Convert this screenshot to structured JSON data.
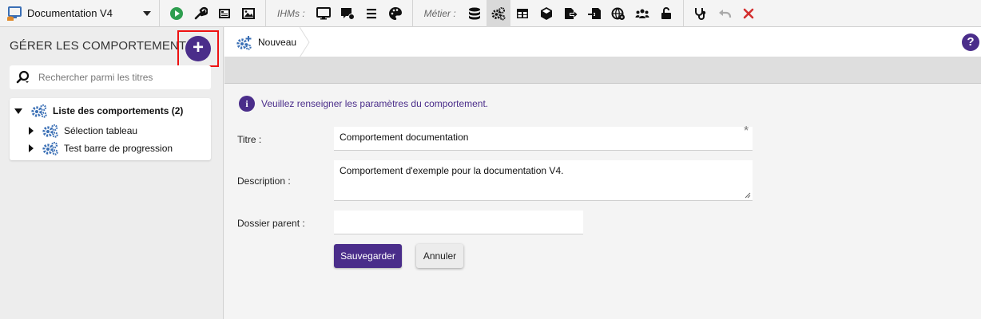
{
  "toolbar": {
    "project_name": "Documentation V4",
    "ihms_label": "IHMs :",
    "metier_label": "Métier :",
    "general_icons": [
      "play-icon",
      "wrench-icon",
      "book-icon",
      "image-icon"
    ],
    "ihm_icons": [
      "monitor-icon",
      "screen-alert-icon",
      "list-icon",
      "palette-icon"
    ],
    "metier_icons": [
      "database-icon",
      "gears-icon",
      "table-icon",
      "cube-icon",
      "export-icon",
      "import-icon",
      "globe-settings-icon",
      "users-icon",
      "unlock-icon"
    ],
    "end_icons": [
      "stethoscope-icon",
      "undo-icon",
      "close-icon"
    ]
  },
  "sidebar": {
    "title": "GÉRER LES COMPORTEMENTS",
    "add_label": "+",
    "search_placeholder": "Rechercher parmi les titres",
    "tree": {
      "root_label": "Liste des comportements (2)",
      "children": [
        {
          "label": "Sélection tableau"
        },
        {
          "label": "Test barre de progression"
        }
      ]
    }
  },
  "tab": {
    "label": "Nouveau",
    "help_label": "?"
  },
  "form": {
    "info_icon": "i",
    "info_text": "Veuillez renseigner les paramètres du comportement.",
    "title_label": "Titre :",
    "title_value": "Comportement documentation",
    "required_mark": "*",
    "description_label": "Description :",
    "description_value": "Comportement d'exemple pour la documentation V4.",
    "parent_label": "Dossier parent :",
    "parent_value": "",
    "save_label": "Sauvegarder",
    "cancel_label": "Annuler"
  },
  "colors": {
    "accent": "#4a2d8a",
    "highlight_border": "#e11111",
    "play": "#2e9e4f",
    "close": "#d32f2f",
    "gear_blue": "#3a6fb5"
  }
}
